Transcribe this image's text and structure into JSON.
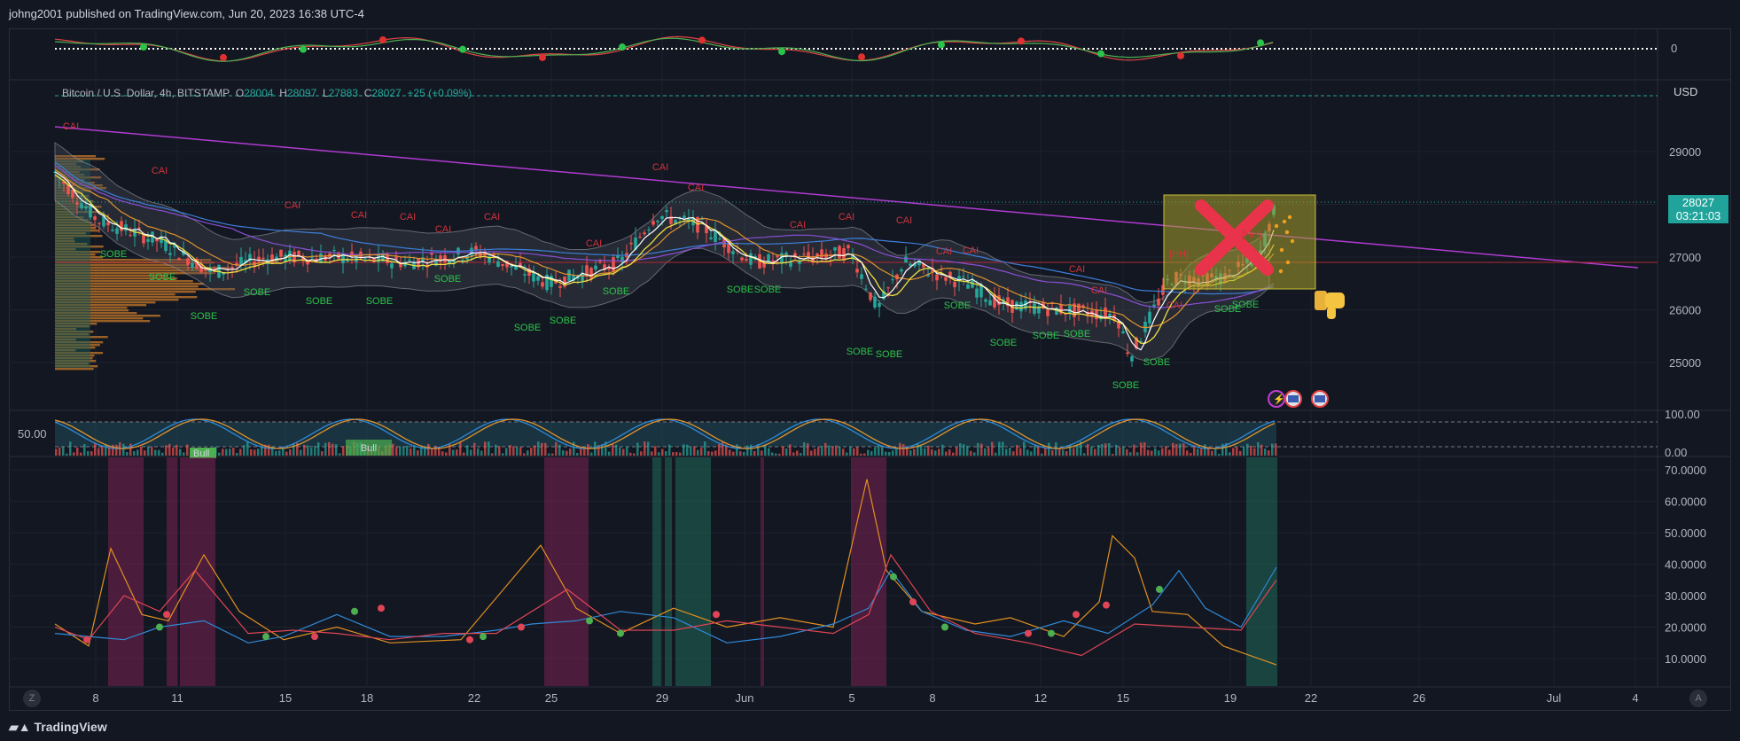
{
  "header": {
    "publish_line": "johng2001 published on TradingView.com, Jun 20, 2023 16:38 UTC-4"
  },
  "legend": {
    "symbol": "Bitcoin / U.S. Dollar, 4h, BITSTAMP",
    "o_label": "O",
    "o_value": "28004",
    "h_label": "H",
    "h_value": "28097",
    "l_label": "L",
    "l_value": "27883",
    "c_label": "C",
    "c_value": "28027",
    "change": "+25 (+0.09%)"
  },
  "price_axis": {
    "currency": "USD",
    "ticks": [
      "29000",
      "28000",
      "27000",
      "26000",
      "25000"
    ],
    "last_price": "28027",
    "countdown": "03:21:03"
  },
  "top_pane": {
    "zero_label": "0"
  },
  "stoch_pane": {
    "left_label": "50.00",
    "ticks": [
      "100.00",
      "0.00"
    ],
    "bull_label": "Bull"
  },
  "bottom_pane": {
    "ticks": [
      "70.0000",
      "60.0000",
      "50.0000",
      "40.0000",
      "30.0000",
      "20.0000",
      "10.0000"
    ]
  },
  "time_axis": {
    "labels": [
      "8",
      "11",
      "15",
      "18",
      "22",
      "25",
      "29",
      "Jun",
      "5",
      "8",
      "12",
      "15",
      "19",
      "22",
      "26",
      "Jul",
      "4"
    ]
  },
  "signals": {
    "sell_label": "CAI",
    "buy_label": "SOBE",
    "hh_label": "[HH]"
  },
  "footer": {
    "brand": "TradingView",
    "z_btn": "Z",
    "a_btn": "A"
  },
  "colors": {
    "background": "#131722",
    "up": "#26a69a",
    "down": "#ef5350",
    "trendline": "#b03bd1",
    "box": "#a8a02a",
    "cross": "#e8334a",
    "price_tag": "#1fa39a"
  }
}
